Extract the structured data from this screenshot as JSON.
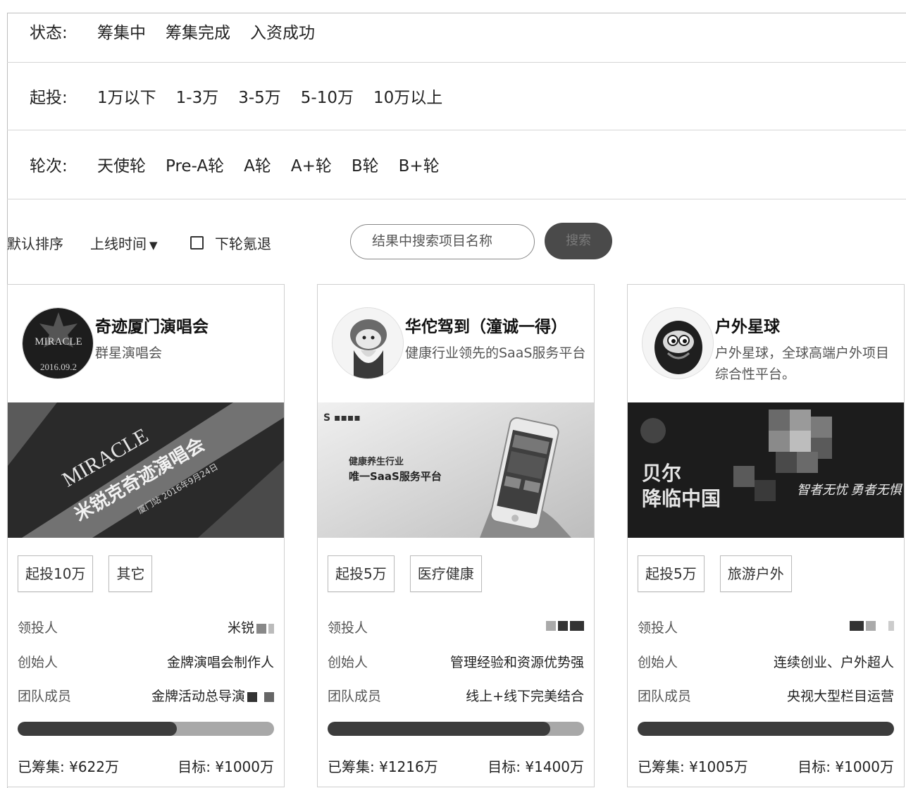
{
  "filters": {
    "status": {
      "label": "状态:",
      "options": [
        "筹集中",
        "筹集完成",
        "入资成功"
      ]
    },
    "min_invest": {
      "label": "起投:",
      "options": [
        "1万以下",
        "1-3万",
        "3-5万",
        "5-10万",
        "10万以上"
      ]
    },
    "round": {
      "label": "轮次:",
      "options": [
        "天使轮",
        "Pre-A轮",
        "A轮",
        "A+轮",
        "B轮",
        "B+轮"
      ]
    }
  },
  "toolbar": {
    "sort_default": "默认排序",
    "sort_time": "上线时间",
    "retreat_label": "下轮氪退",
    "search_placeholder": "结果中搜索项目名称",
    "search_button": "搜索"
  },
  "cards": [
    {
      "title": "奇迹厦门演唱会",
      "subtitle": "群星演唱会",
      "avatar_text": "MIRACLE",
      "avatar_date": "2016.09.2",
      "banner_text": "米锐克奇迹演唱会",
      "banner_sub": "厦门站 2016年9月24日",
      "banner_brand": "MIRACLE",
      "tags": [
        "起投10万",
        "其它"
      ],
      "lead_label": "领投人",
      "lead_value": "米锐",
      "founder_label": "创始人",
      "founder_value": "金牌演唱会制作人",
      "team_label": "团队成员",
      "team_value": "金牌活动总导演",
      "progress": 0.622,
      "raised": "已筹集: ¥622万",
      "target": "目标: ¥1000万"
    },
    {
      "title": "华佗驾到（潼诚一得）",
      "subtitle": "健康行业领先的SaaS服务平台",
      "banner_text": "健康养生行业",
      "banner_sub": "唯一SaaS服务平台",
      "tags": [
        "起投5万",
        "医疗健康"
      ],
      "lead_label": "领投人",
      "lead_value": "",
      "founder_label": "创始人",
      "founder_value": "管理经验和资源优势强",
      "team_label": "团队成员",
      "team_value": "线上+线下完美结合",
      "progress": 0.8686,
      "raised": "已筹集: ¥1216万",
      "target": "目标: ¥1400万"
    },
    {
      "title": "户外星球",
      "subtitle": "户外星球，全球高端户外项目综合性平台。",
      "banner_text": "贝尔",
      "banner_text2": "降临中国",
      "banner_sub": "智者无忧 勇者无惧",
      "tags": [
        "起投5万",
        "旅游户外"
      ],
      "lead_label": "领投人",
      "lead_value": "",
      "founder_label": "创始人",
      "founder_value": "连续创业、户外超人",
      "team_label": "团队成员",
      "team_value": "央视大型栏目运营",
      "progress": 1.0,
      "raised": "已筹集: ¥1005万",
      "target": "目标: ¥1000万"
    }
  ]
}
